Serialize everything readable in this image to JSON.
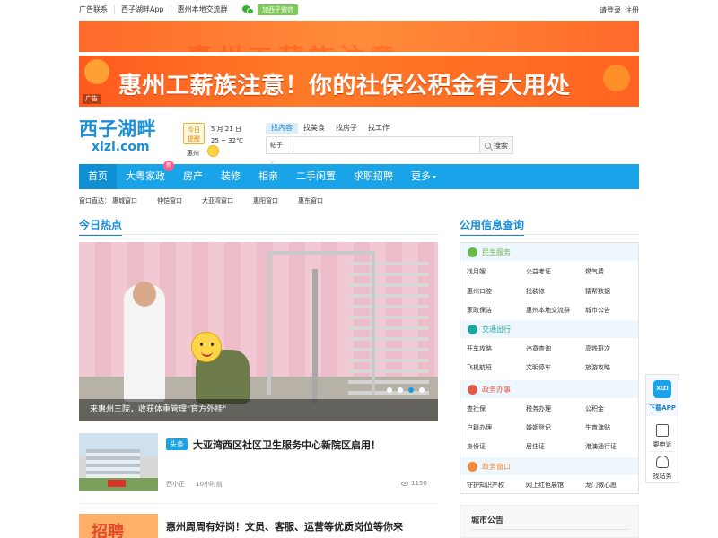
{
  "topbar": {
    "links": [
      "广告联系",
      "西子湖畔App",
      "惠州本地交流群"
    ],
    "wechat_btn": "加西子微信",
    "login": "请登录",
    "register": "注册"
  },
  "banners": {
    "banner1_text": "惠州工薪族注意",
    "banner2_text": "惠州工薪族注意！你的社保公积金有大用处",
    "ad_tag": "广告"
  },
  "logo": {
    "cn": "西子湖畔",
    "en": "xizi.com"
  },
  "daytip": {
    "line1": "今日",
    "line2": "提醒"
  },
  "weather": {
    "date": "5 月 21 日",
    "temp": "25 ~ 32℃",
    "city": "惠州"
  },
  "search": {
    "tabs": [
      "找内容",
      "找美食",
      "找房子",
      "找工作"
    ],
    "category": "帖子",
    "placeholder": "",
    "button": "搜索"
  },
  "nav": {
    "items": [
      "首页",
      "大粤家政",
      "房产",
      "装修",
      "相亲",
      "二手闲置",
      "求职招聘",
      "更多"
    ],
    "new_badge": "新"
  },
  "winbar": {
    "label": "窗口直达：",
    "items": [
      "惠城窗口",
      "仲恺窗口",
      "大亚湾窗口",
      "惠阳窗口",
      "惠东窗口"
    ]
  },
  "hot": {
    "title": "今日热点",
    "hero_caption": "来惠州三院，收获体重管理\"官方外挂\"",
    "news": [
      {
        "tag": "头条",
        "title": "大亚湾西区社区卫生服务中心新院区启用！",
        "author": "西小正",
        "time": "10小时前",
        "views": "1150"
      },
      {
        "title": "惠州周周有好岗！文员、客服、运营等优质岗位等你来",
        "thumb_text": "招聘"
      }
    ]
  },
  "public": {
    "title": "公用信息查询",
    "categories": [
      {
        "name": "民生服务",
        "color": "#6bb84a",
        "rows": [
          [
            "找月嫂",
            "公益考证",
            "燃气费"
          ],
          [
            "惠州口腔",
            "找装修",
            "猿帮数据"
          ],
          [
            "家政保洁",
            "惠州本地交流群",
            "城市公告"
          ]
        ]
      },
      {
        "name": "交通出行",
        "color": "#1da7a0",
        "rows": [
          [
            "开车攻略",
            "违章查询",
            "高铁班次"
          ],
          [
            "飞机航班",
            "文明停车",
            "旅游攻略"
          ]
        ]
      },
      {
        "name": "政务办事",
        "color": "#e05a4a",
        "rows": [
          [
            "查社保",
            "税务办理",
            "公积金"
          ],
          [
            "户籍办理",
            "婚姻登记",
            "生育津贴"
          ],
          [
            "身份证",
            "居住证",
            "港澳通行证"
          ]
        ]
      },
      {
        "name": "政务窗口",
        "color": "#f08a3a",
        "rows": [
          [
            "守护知识产权",
            "网上红色展馆",
            "龙门微心愿"
          ]
        ]
      }
    ]
  },
  "city_notice": {
    "title": "城市公告"
  },
  "float": {
    "app_logo": "XIZI",
    "app_label": "下载APP",
    "complain": "要申诉",
    "service": "找站务"
  }
}
